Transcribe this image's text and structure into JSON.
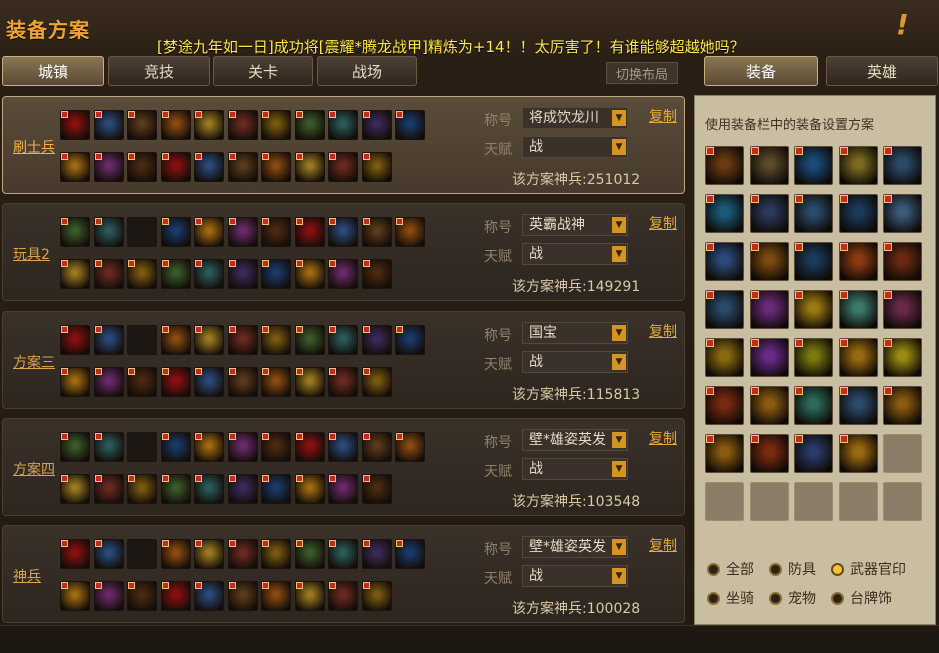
{
  "header": {
    "title": "装备方案",
    "announcement": "[梦途九年如一日]成功将[震耀*腾龙战甲]精炼为+14！！太厉害了！有谁能够超越她吗？",
    "alert_glyph": "!"
  },
  "tabs": [
    "城镇",
    "竞技",
    "关卡",
    "战场"
  ],
  "active_tab": "城镇",
  "layout_button": "切换布局",
  "right_tabs": [
    "装备",
    "英雄"
  ],
  "field_labels": {
    "title": "称号",
    "talent": "天赋"
  },
  "copy_label": "复制",
  "plans": [
    {
      "name": "刷士兵",
      "title": "将成饮龙川",
      "talent": "战",
      "score_text": "该方案神兵:251012"
    },
    {
      "name": "玩具2",
      "title": "英霸战神",
      "talent": "战",
      "score_text": "该方案神兵:149291"
    },
    {
      "name": "方案三",
      "title": "国宝",
      "talent": "战",
      "score_text": "该方案神兵:115813"
    },
    {
      "name": "方案四",
      "title": "壁*雄姿英发",
      "talent": "战",
      "score_text": "该方案神兵:103548"
    },
    {
      "name": "神兵",
      "title": "壁*雄姿英发",
      "talent": "战",
      "score_text": "该方案神兵:100028"
    }
  ],
  "inventory": {
    "title": "使用装备栏中的装备设置方案",
    "filters": [
      {
        "label": "全部",
        "selected": false
      },
      {
        "label": "防具",
        "selected": false
      },
      {
        "label": "武器官印",
        "selected": true
      },
      {
        "label": "坐骑",
        "selected": false
      },
      {
        "label": "宠物",
        "selected": false
      },
      {
        "label": "台牌饰",
        "selected": false
      }
    ]
  },
  "colors": {
    "accent": "#f0a236",
    "announcement": "#ffe84a",
    "panel": "#c9bda2"
  }
}
